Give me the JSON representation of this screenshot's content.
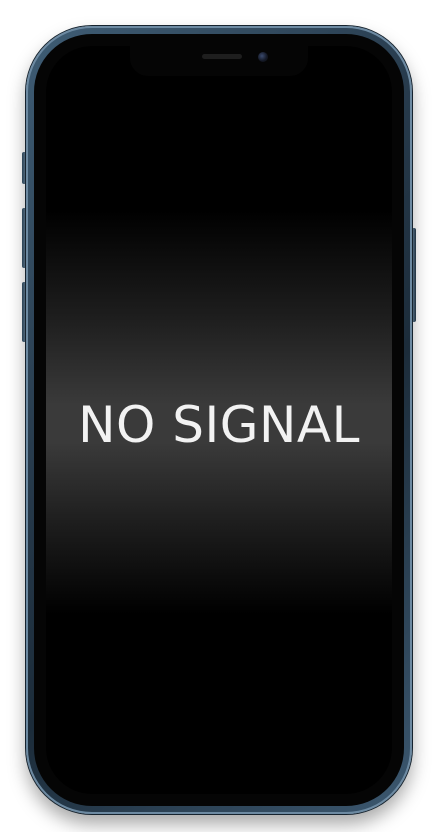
{
  "screen": {
    "message": "NO SIGNAL"
  },
  "device": {
    "frame_color": "#2c4257",
    "screen_color": "#000000",
    "text_color": "#f2f2f2"
  },
  "icons": {
    "front_camera": "front-camera-icon",
    "earpiece": "earpiece-speaker-icon"
  }
}
